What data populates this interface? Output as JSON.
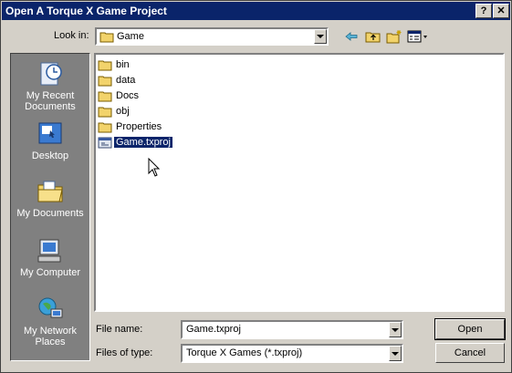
{
  "window": {
    "title": "Open A Torque X Game Project",
    "help_glyph": "?",
    "close_glyph": "✕"
  },
  "toolbar": {
    "look_in_label": "Look in:",
    "look_in_value": "Game",
    "icons": [
      "back-icon",
      "up-folder-icon",
      "new-folder-icon",
      "view-menu-icon"
    ]
  },
  "places": [
    {
      "name": "recent",
      "label": "My Recent Documents"
    },
    {
      "name": "desktop",
      "label": "Desktop"
    },
    {
      "name": "documents",
      "label": "My Documents"
    },
    {
      "name": "computer",
      "label": "My Computer"
    },
    {
      "name": "network",
      "label": "My Network Places"
    }
  ],
  "files": [
    {
      "name": "bin",
      "type": "folder"
    },
    {
      "name": "data",
      "type": "folder"
    },
    {
      "name": "Docs",
      "type": "folder"
    },
    {
      "name": "obj",
      "type": "folder"
    },
    {
      "name": "Properties",
      "type": "folder"
    },
    {
      "name": "Game.txproj",
      "type": "file",
      "selected": true
    }
  ],
  "footer": {
    "file_name_label": "File name:",
    "file_name_value": "Game.txproj",
    "file_type_label": "Files of type:",
    "file_type_value": "Torque X Games (*.txproj)",
    "open_label": "Open",
    "cancel_label": "Cancel"
  },
  "colors": {
    "titlebar": "#0a246a",
    "face": "#d4d0c8",
    "places_bg": "#808080",
    "folder": "#f2d36b"
  }
}
